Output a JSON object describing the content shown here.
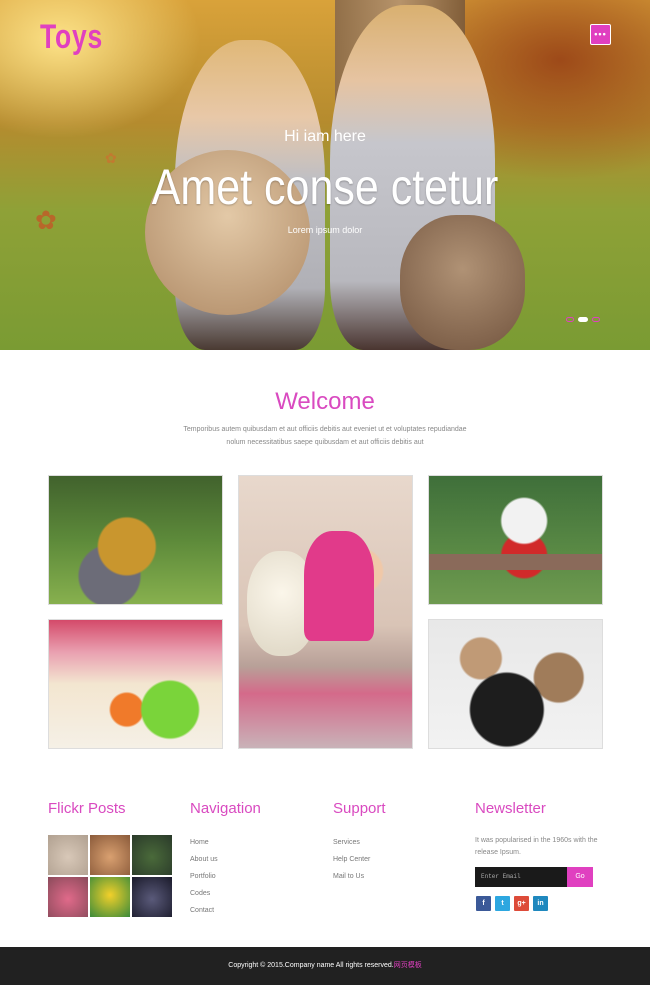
{
  "header": {
    "logo": "Toys",
    "menu_icon": "more-dots-icon"
  },
  "hero": {
    "small_text": "Hi iam here",
    "title": "Amet conse ctetur",
    "subtitle": "Lorem ipsum dolor",
    "slides": 3,
    "active_slide": 2
  },
  "welcome": {
    "title": "Welcome",
    "text": "Temporibus autem quibusdam et aut officiis debitis aut eveniet ut et voluptates repudiandae nolum necessitatibus saepe quibusdam et aut officiis debitis aut"
  },
  "footer": {
    "flickr_title": "Flickr Posts",
    "navigation_title": "Navigation",
    "navigation_items": [
      "Home",
      "About us",
      "Portfolio",
      "Codes",
      "Contact"
    ],
    "support_title": "Support",
    "support_items": [
      "Services",
      "Help Center",
      "Mail to Us"
    ],
    "newsletter_title": "Newsletter",
    "newsletter_text": "It was popularised in the 1960s with the release Ipsum.",
    "email_placeholder": "Enter Email",
    "go_label": "Go",
    "social": [
      "f",
      "t",
      "g+",
      "in"
    ]
  },
  "copyright": {
    "text": "Copyright © 2015.Company name All rights reserved.",
    "brand": "网页模板"
  },
  "colors": {
    "accent": "#e040c0",
    "dark": "#212121"
  }
}
